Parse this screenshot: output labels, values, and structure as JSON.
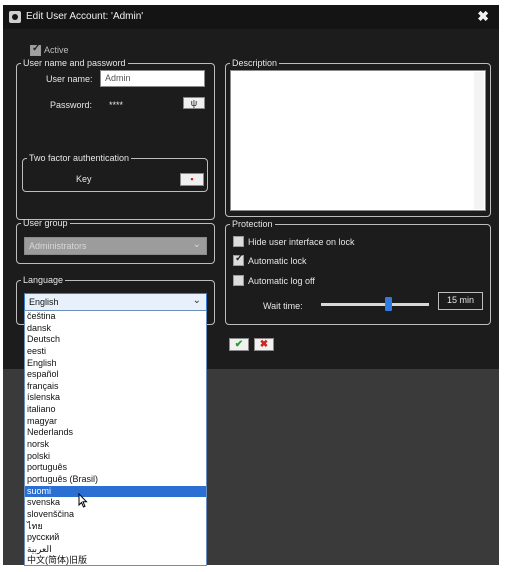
{
  "window": {
    "title": "Edit User Account: 'Admin'"
  },
  "active": {
    "label": "Active",
    "checked": true
  },
  "credentials": {
    "legend": "User name and password",
    "username_label": "User name:",
    "username_value": "Admin",
    "password_label": "Password:",
    "password_value": "****"
  },
  "two_factor": {
    "legend": "Two factor authentication",
    "key_label": "Key"
  },
  "description": {
    "legend": "Description"
  },
  "user_group": {
    "legend": "User group",
    "value": "Administrators"
  },
  "protection": {
    "legend": "Protection",
    "hide_ui": {
      "label": "Hide user interface on lock",
      "checked": false
    },
    "auto_lock": {
      "label": "Automatic lock",
      "checked": true
    },
    "auto_logoff": {
      "label": "Automatic log off",
      "checked": false
    },
    "wait_time_label": "Wait time:",
    "wait_time_value": "15 min",
    "slider_fraction": 0.62
  },
  "language": {
    "legend": "Language",
    "selected": "English",
    "options": [
      "čeština",
      "dansk",
      "Deutsch",
      "eesti",
      "English",
      "español",
      "français",
      "íslenska",
      "italiano",
      "magyar",
      "Nederlands",
      "norsk",
      "polski",
      "português",
      "português (Brasil)",
      "suomi",
      "svenska",
      "slovenščina",
      "ไทย",
      "русский",
      "العربية",
      "中文(简体)旧版"
    ],
    "highlighted": "suomi"
  },
  "colors": {
    "accent": "#2a6fd1",
    "ok": "#2a9d2a",
    "cancel": "#d02020",
    "dialog_bg": "#1c1c1c"
  }
}
